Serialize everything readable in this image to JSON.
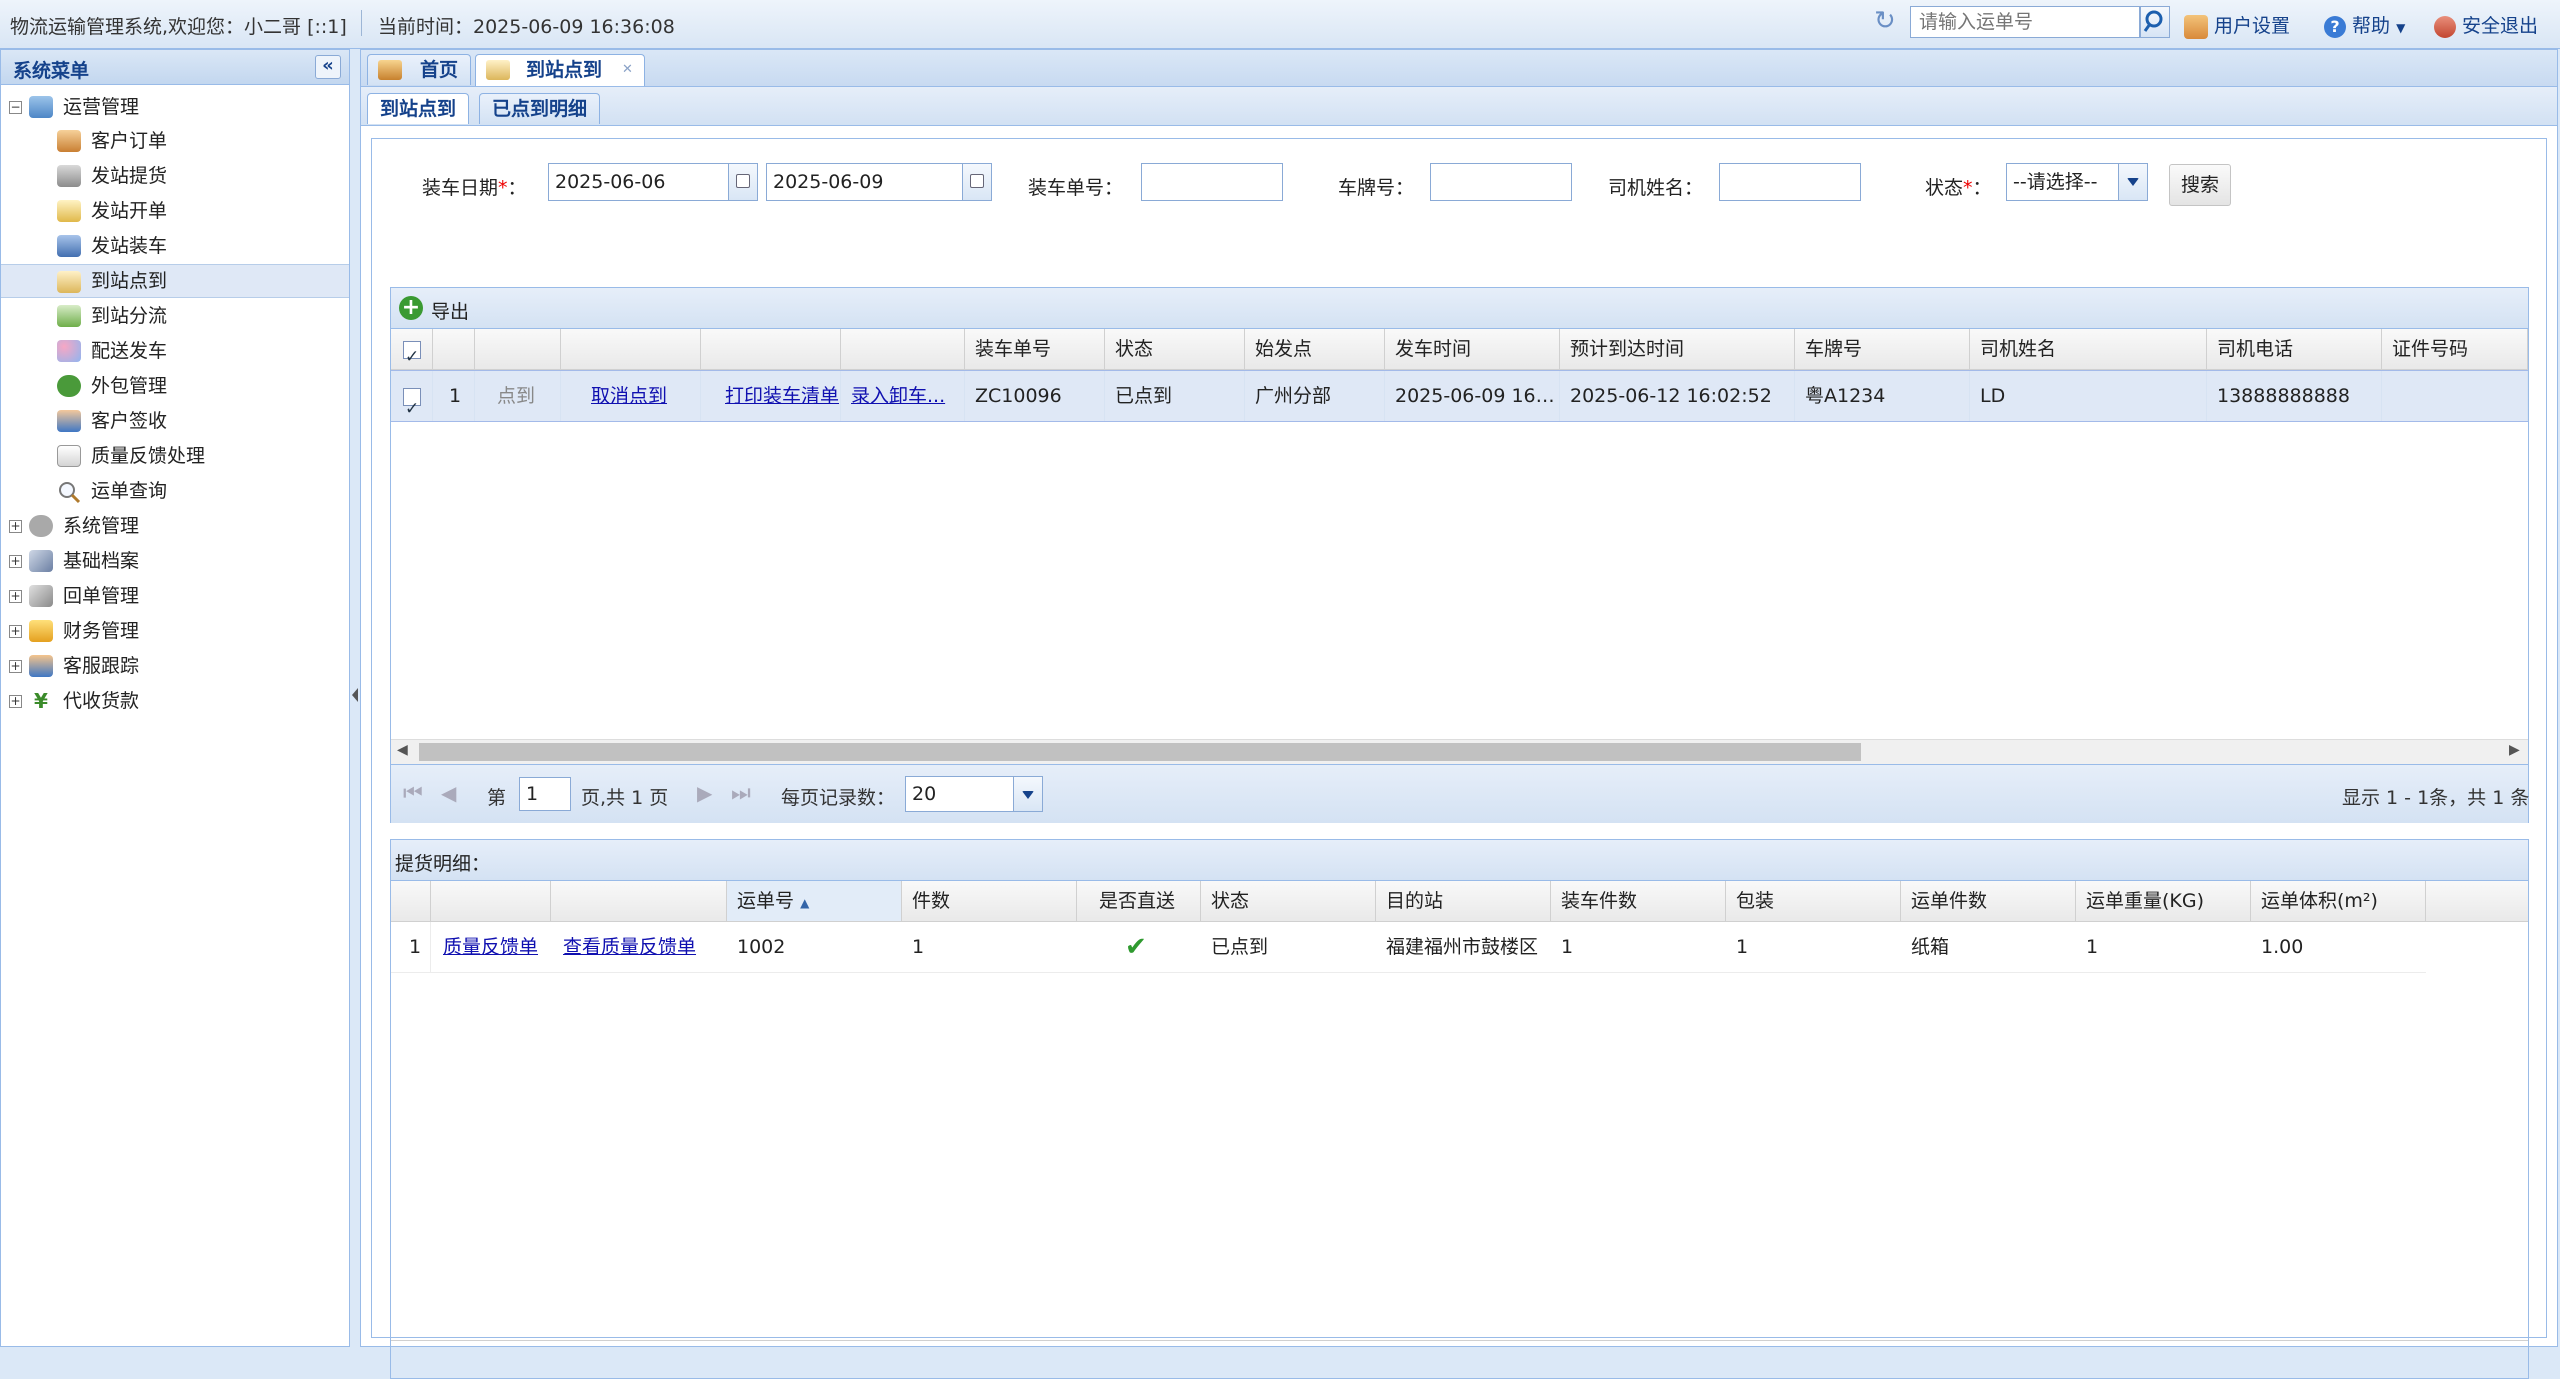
{
  "topbar": {
    "welcome": "物流运输管理系统,欢迎您：小二哥 [::1]",
    "current_time": "当前时间：2025-06-09 16:36:08",
    "search_placeholder": "请输入运单号",
    "user_settings": "用户设置",
    "help": "帮助",
    "logout": "安全退出"
  },
  "sidebar": {
    "title": "系统菜单",
    "groups": [
      {
        "label": "运营管理",
        "expanded": true,
        "icon": "network-icon"
      },
      {
        "label": "系统管理",
        "expanded": false,
        "icon": "gear-icon"
      },
      {
        "label": "基础档案",
        "expanded": false,
        "icon": "wrench-icon"
      },
      {
        "label": "回单管理",
        "expanded": false,
        "icon": "pill-icon"
      },
      {
        "label": "财务管理",
        "expanded": false,
        "icon": "coins-icon"
      },
      {
        "label": "客服跟踪",
        "expanded": false,
        "icon": "users-icon"
      },
      {
        "label": "代收货款",
        "expanded": false,
        "icon": "yen-icon"
      }
    ],
    "items": [
      {
        "label": "客户订单",
        "icon": "person-icon"
      },
      {
        "label": "发站提货",
        "icon": "cart-icon"
      },
      {
        "label": "发站开单",
        "icon": "edit-icon"
      },
      {
        "label": "发站装车",
        "icon": "car-icon"
      },
      {
        "label": "到站点到",
        "icon": "checklist-icon",
        "selected": true
      },
      {
        "label": "到站分流",
        "icon": "branch-icon"
      },
      {
        "label": "配送发车",
        "icon": "balls-icon"
      },
      {
        "label": "外包管理",
        "icon": "gear-green-icon"
      },
      {
        "label": "客户签收",
        "icon": "user-sign-icon"
      },
      {
        "label": "质量反馈处理",
        "icon": "form-icon"
      },
      {
        "label": "运单查询",
        "icon": "magnifier-icon"
      }
    ]
  },
  "tabs": [
    {
      "label": "首页",
      "icon": "home-icon"
    },
    {
      "label": "到站点到",
      "icon": "checklist-icon",
      "active": true
    }
  ],
  "subtabs": [
    {
      "label": "到站点到",
      "active": true
    },
    {
      "label": "已点到明细"
    }
  ],
  "filters": {
    "load_date_label": "装车日期",
    "date_from": "2025-06-06",
    "date_to": "2025-06-09",
    "load_no_label": "装车单号：",
    "plate_label": "车牌号：",
    "driver_label": "司机姓名：",
    "status_label": "状态",
    "status_value": "--请选择--",
    "search_button": "搜索",
    "required_mark": "*",
    "colon": "："
  },
  "grid1": {
    "toolbar_export": "导出",
    "columns": [
      "装车单号",
      "状态",
      "始发点",
      "发车时间",
      "预计到达时间",
      "车牌号",
      "司机姓名",
      "司机电话",
      "证件号码"
    ],
    "rows": [
      {
        "index": "1",
        "action_checkin": "点到",
        "action_cancel": "取消点到",
        "action_print": "打印装车清单",
        "action_unload": "录入卸车...",
        "load_no": "ZC10096",
        "status": "已点到",
        "origin": "广州分部",
        "depart_time": "2025-06-09 16:...",
        "eta": "2025-06-12 16:02:52",
        "plate": "粤A1234",
        "driver": "LD",
        "phone": "13888888888",
        "id_no": ""
      }
    ],
    "pager": {
      "page_prefix": "第",
      "page_value": "1",
      "page_suffix": "页,共 1 页",
      "page_size_label": "每页记录数：",
      "page_size": "20",
      "summary": "显示 1 - 1条，共 1 条"
    }
  },
  "grid2": {
    "title": "提货明细：",
    "columns": [
      "运单号",
      "件数",
      "是否直送",
      "状态",
      "目的站",
      "装车件数",
      "包装",
      "运单件数",
      "运单重量(KG)",
      "运单体积(m²)"
    ],
    "rows": [
      {
        "index": "1",
        "action_feedback": "质量反馈单",
        "action_view": "查看质量反馈单",
        "waybill_no": "1002",
        "count": "1",
        "direct": true,
        "status": "已点到",
        "destination": "福建福州市鼓楼区",
        "load_count": "1",
        "packing_count": "1",
        "packing": "纸箱",
        "weight": "1",
        "volume": "1.00"
      }
    ]
  }
}
